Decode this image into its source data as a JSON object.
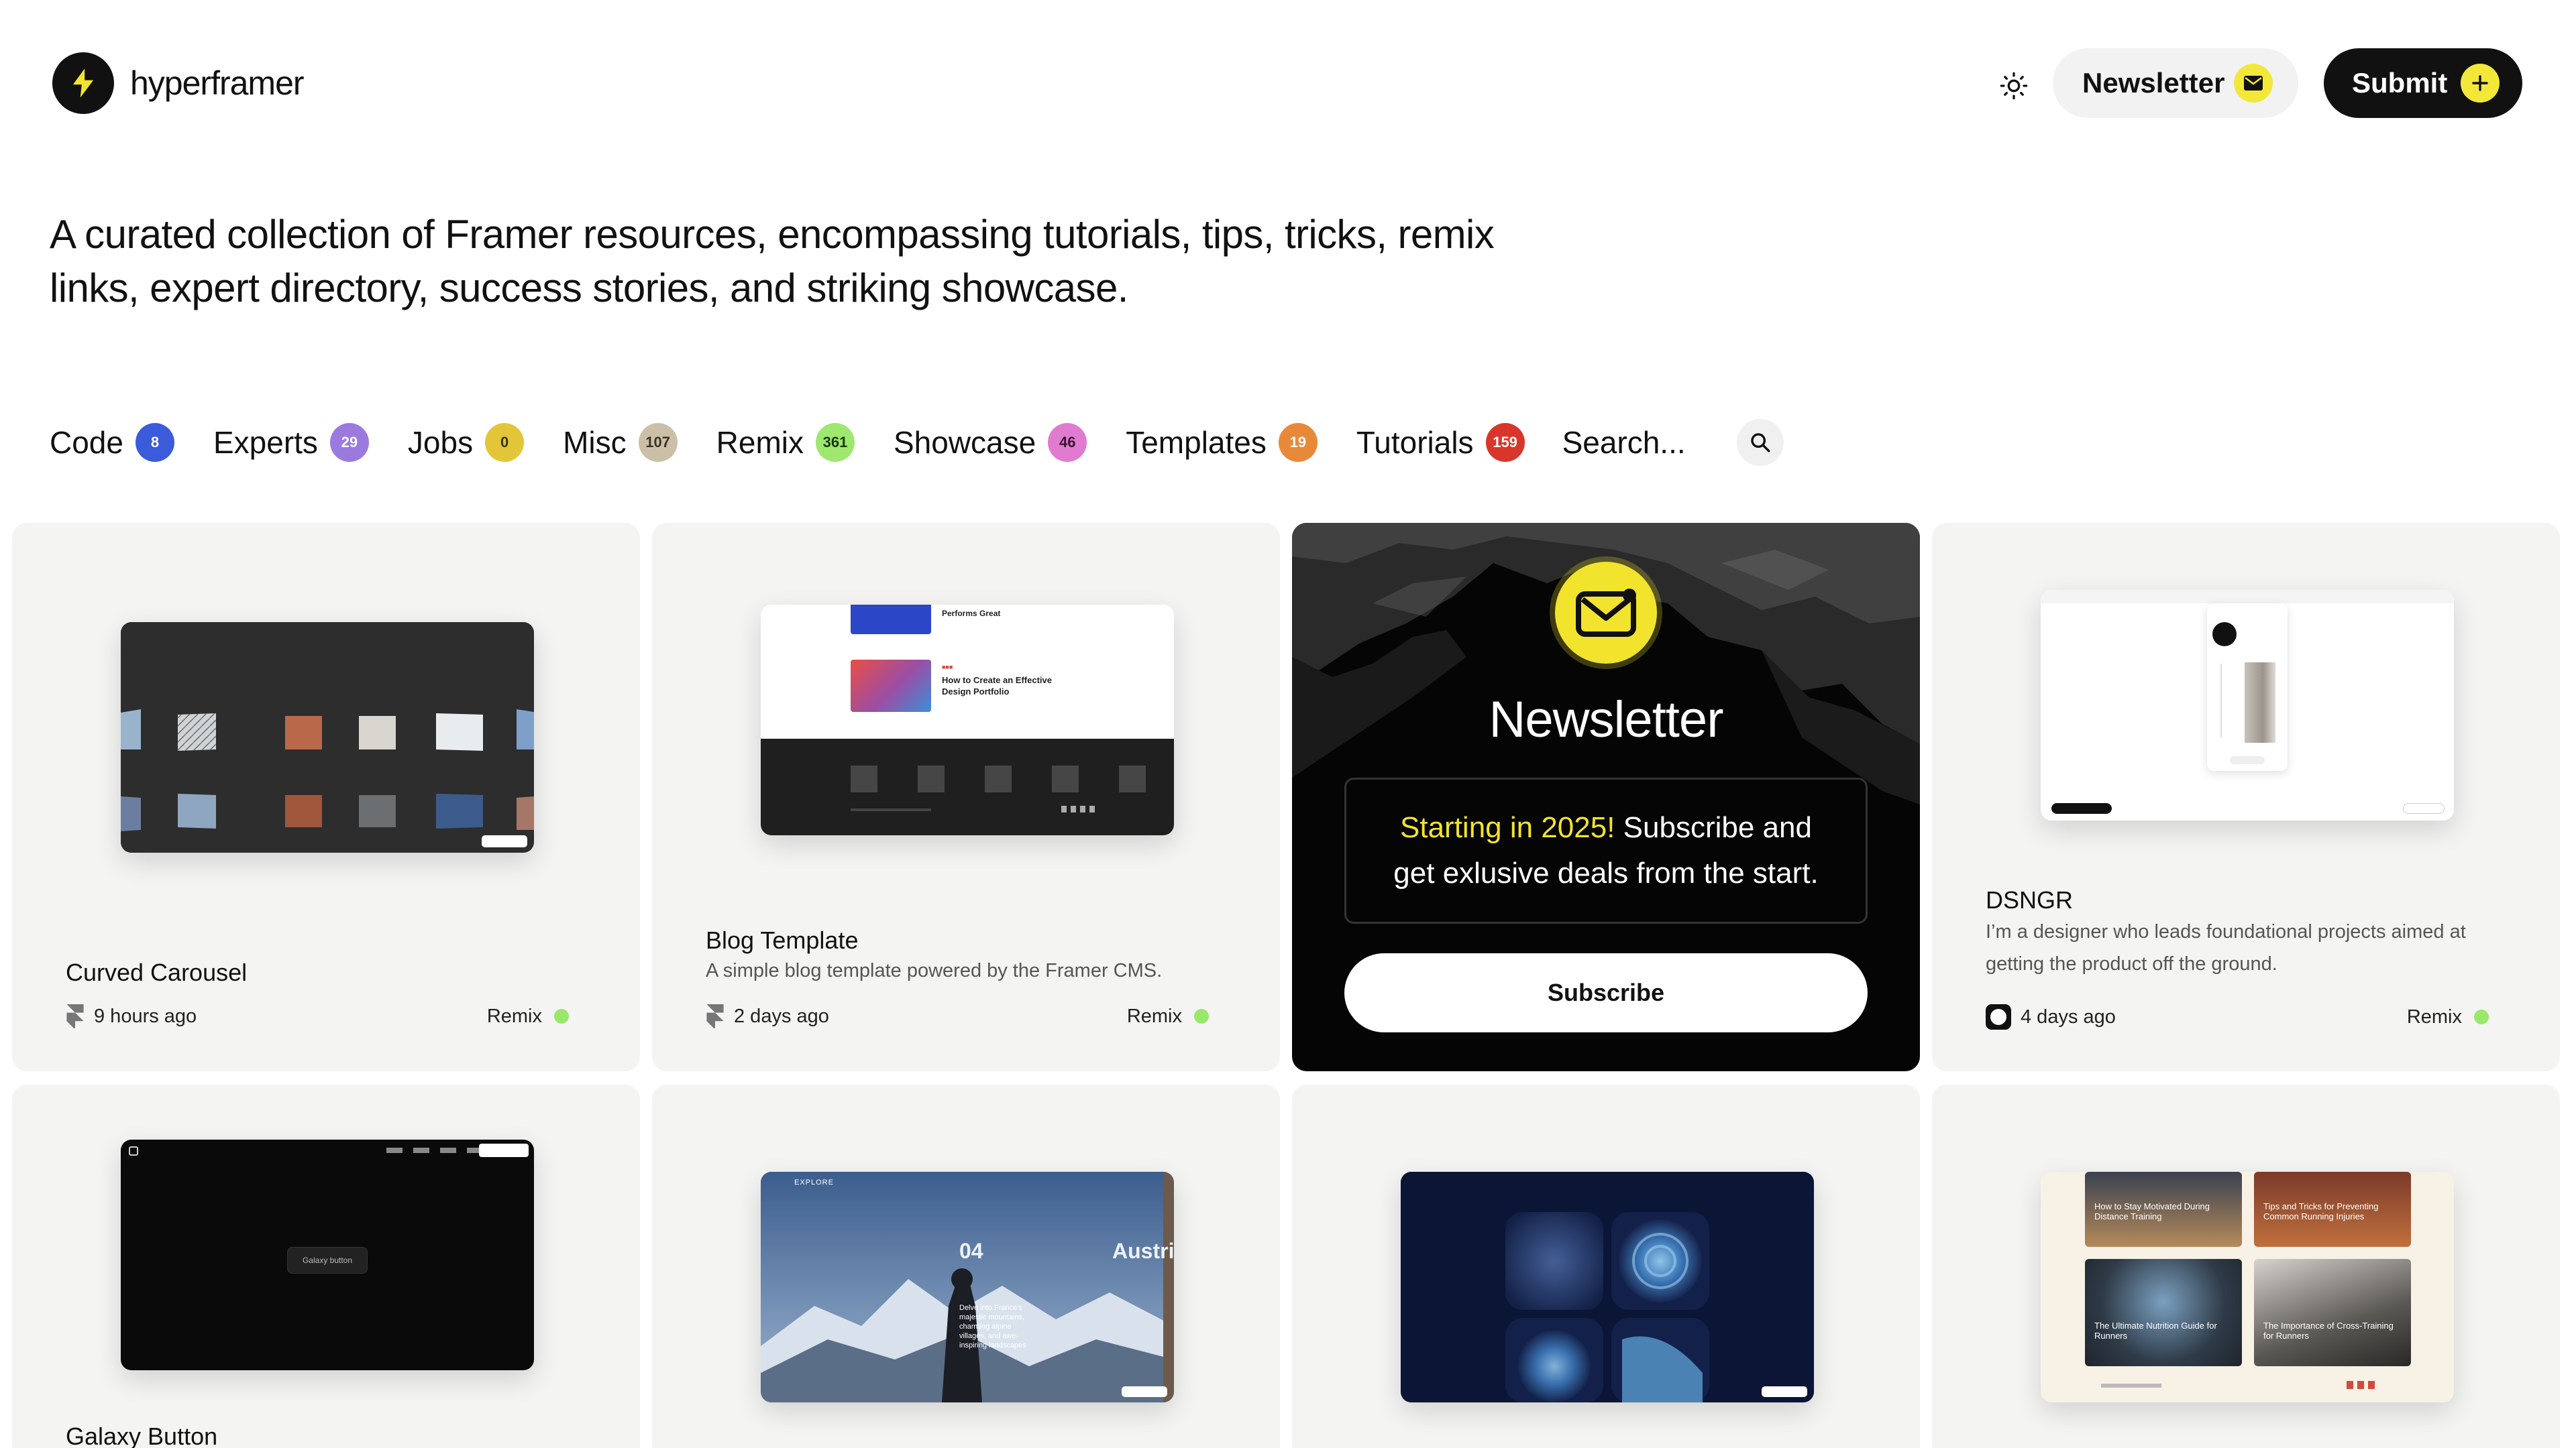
{
  "brand": {
    "name": "hyperframer"
  },
  "header": {
    "theme_icon": "sun-icon",
    "newsletter_label": "Newsletter",
    "submit_label": "Submit"
  },
  "tagline": "A curated collection of Framer resources, encompassing tutorials, tips, tricks, remix links, expert directory, success stories, and striking showcase.",
  "categories": [
    {
      "label": "Code",
      "count": "8",
      "color": "#3b5bdb"
    },
    {
      "label": "Experts",
      "count": "29",
      "color": "#9b7ae0"
    },
    {
      "label": "Jobs",
      "count": "0",
      "color": "#e3c637"
    },
    {
      "label": "Misc",
      "count": "107",
      "color": "#cbbfa8"
    },
    {
      "label": "Remix",
      "count": "361",
      "color": "#9fe870"
    },
    {
      "label": "Showcase",
      "count": "46",
      "color": "#e07bd0"
    },
    {
      "label": "Templates",
      "count": "19",
      "color": "#e8893a"
    },
    {
      "label": "Tutorials",
      "count": "159",
      "color": "#d9362b"
    }
  ],
  "search": {
    "placeholder": "Search..."
  },
  "cards": [
    {
      "title": "Curved Carousel",
      "time": "9 hours ago",
      "tag": "Remix"
    },
    {
      "title": "Blog Template",
      "desc": "A simple blog template powered by the Framer CMS.",
      "time": "2 days ago",
      "tag": "Remix"
    },
    {
      "title": "DSNGR",
      "desc": "I’m a designer who leads foundational projects aimed at getting the product off the ground.",
      "time": "4 days ago",
      "tag": "Remix"
    },
    {
      "title": "Galaxy Button"
    }
  ],
  "newsletter": {
    "title": "Newsletter",
    "highlight": "Starting in 2025!",
    "text": " Subscribe and get exlusive deals from the start.",
    "button": "Subscribe"
  },
  "thumbs": {
    "blog_post_1": "How to Create an Effective Design Portfolio",
    "blog_post_0": "Performs Great",
    "galaxy_btn": "Galaxy button",
    "mountain_num": "04",
    "mountain_word": "Austri",
    "mountain_nav": "EXPLORE",
    "mountain_caption": "Delve into France's majestic mountains, charming alpine villages, and awe-inspiring landscapes",
    "running": [
      "How to Stay Motivated During Distance Training",
      "Tips and Tricks for Preventing Common Running Injuries",
      "The Ultimate Nutrition Guide for Runners",
      "The Importance of Cross-Training for Runners"
    ],
    "remix_badge": "Remix in Framer"
  }
}
